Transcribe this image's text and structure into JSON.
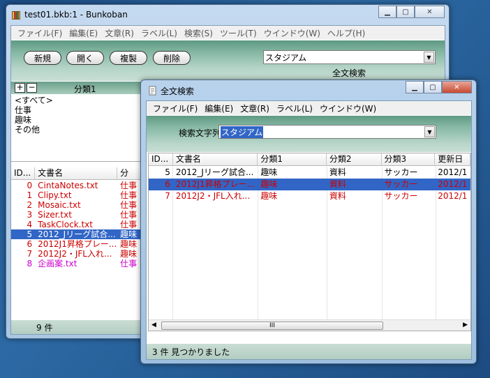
{
  "main_window": {
    "title": "test01.bkb:1 - Bunkoban",
    "menu": [
      "ファイル(F)",
      "編集(E)",
      "文章(R)",
      "ラベル(L)",
      "検索(S)",
      "ツール(T)",
      "ウインドウ(W)",
      "ヘルプ(H)"
    ],
    "buttons": {
      "new": "新規",
      "open": "開く",
      "duplicate": "複製",
      "delete": "削除"
    },
    "search_combo_value": "スタジアム",
    "fulltext_search_label": "全文検索",
    "category_panel": {
      "plus": "+",
      "minus": "−",
      "header": "分類1",
      "items": [
        "<すべて>",
        "仕事",
        "趣味",
        "その他"
      ]
    },
    "list_headers": [
      "ID...",
      "文書名",
      "分"
    ],
    "list_rows": [
      {
        "id": "0",
        "name": "CintaNotes.txt",
        "cat": "仕事",
        "color": "#cc0000"
      },
      {
        "id": "1",
        "name": "Clipy.txt",
        "cat": "仕事",
        "color": "#cc0000"
      },
      {
        "id": "2",
        "name": "Mosaic.txt",
        "cat": "仕事",
        "color": "#cc0000"
      },
      {
        "id": "3",
        "name": "Sizer.txt",
        "cat": "仕事",
        "color": "#cc0000"
      },
      {
        "id": "4",
        "name": "TaskClock.txt",
        "cat": "仕事",
        "color": "#cc0000"
      },
      {
        "id": "5",
        "name": "2012_Jリーグ試合...",
        "cat": "趣味",
        "color": "#ffffff",
        "selected": true
      },
      {
        "id": "6",
        "name": "2012J1昇格プレー...",
        "cat": "趣味",
        "color": "#cc0000"
      },
      {
        "id": "7",
        "name": "2012J2・JFL入れ...",
        "cat": "趣味",
        "color": "#cc0000"
      },
      {
        "id": "8",
        "name": "企画案.txt",
        "cat": "仕事",
        "color": "#cc00cc"
      }
    ],
    "status": "9 件"
  },
  "search_window": {
    "title": "全文検索",
    "menu": [
      "ファイル(F)",
      "編集(E)",
      "文章(R)",
      "ラベル(L)",
      "ウインドウ(W)"
    ],
    "search_label": "検索文字列:",
    "search_value": "スタジアム",
    "headers": [
      "ID...",
      "文書名",
      "分類1",
      "分類2",
      "分類3",
      "更新日"
    ],
    "rows": [
      {
        "id": "5",
        "name": "2012_Jリーグ試合...",
        "c1": "趣味",
        "c2": "資料",
        "c3": "サッカー",
        "date": "2012/1",
        "color": "#000000"
      },
      {
        "id": "6",
        "name": "2012J1昇格プレー...",
        "c1": "趣味",
        "c2": "資料",
        "c3": "サッカー",
        "date": "2012/1",
        "color": "#cc0000",
        "selected": true
      },
      {
        "id": "7",
        "name": "2012J2・JFL入れ...",
        "c1": "趣味",
        "c2": "資料",
        "c3": "サッカー",
        "date": "2012/1",
        "color": "#cc0000"
      }
    ],
    "status": "3 件 見つかりました",
    "scroll_grip": "III"
  },
  "colors": {
    "accent_green": "#86b8a4",
    "selection": "#3166c7",
    "desktop": "#1d4e86"
  }
}
